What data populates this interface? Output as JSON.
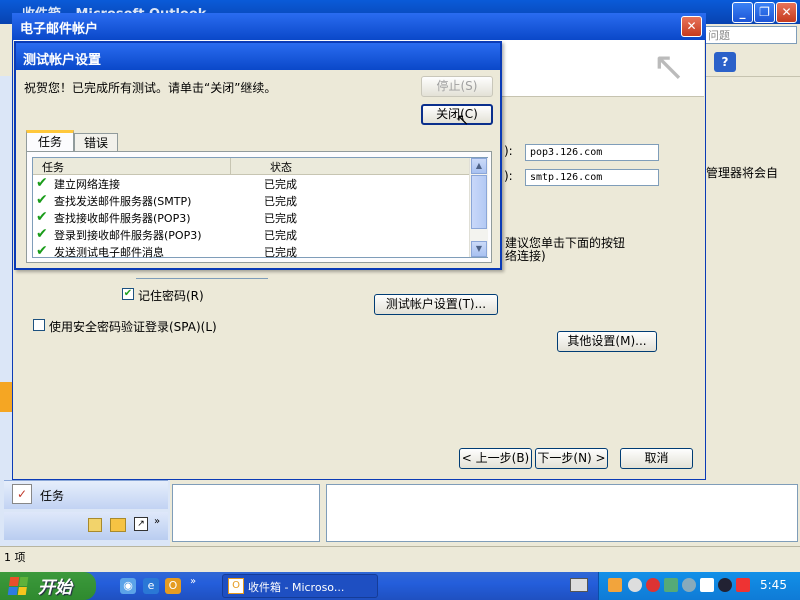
{
  "outlook": {
    "title": "收件箱 - Microsoft Outlook",
    "question_placeholder": "问题",
    "tasks_label": "任务",
    "status_text": "1 项",
    "right_fragment": "管理器将会自"
  },
  "account_dialog": {
    "title": "电子邮件帐户",
    "pop_label": "):",
    "smtp_label": "):",
    "pop_server": "pop3.126.com",
    "smtp_server": "smtp.126.com",
    "advice_line1": "建议您单击下面的按钮",
    "advice_line2": "络连接)",
    "remember_password": "记住密码(R)",
    "remember_checked": true,
    "spa_label": "使用安全密码验证登录(SPA)(L)",
    "spa_checked": false,
    "test_settings_button": "测试帐户设置(T)...",
    "more_settings_button": "其他设置(M)...",
    "back_button": "< 上一步(B)",
    "next_button": "下一步(N) >",
    "cancel_button": "取消"
  },
  "test_dialog": {
    "title": "测试帐户设置",
    "message": "祝贺您！已完成所有测试。请单击“关闭”继续。",
    "stop_button": "停止(S)",
    "close_button": "关闭(C)",
    "tabs": [
      "任务",
      "错误"
    ],
    "columns": [
      "任务",
      "状态"
    ],
    "rows": [
      {
        "task": "建立网络连接",
        "status": "已完成"
      },
      {
        "task": "查找发送邮件服务器(SMTP)",
        "status": "已完成"
      },
      {
        "task": "查找接收邮件服务器(POP3)",
        "status": "已完成"
      },
      {
        "task": "登录到接收邮件服务器(POP3)",
        "status": "已完成"
      },
      {
        "task": "发送测试电子邮件消息",
        "status": "已完成"
      }
    ]
  },
  "taskbar": {
    "start_label": "开始",
    "task_label": "收件箱 - Microso...",
    "clock": "5:45"
  },
  "colors": {
    "titlebar": "#0a48c9",
    "check_green": "#1a9c1a",
    "taskbar": "#245edb",
    "start_green": "#2f8a2f"
  }
}
